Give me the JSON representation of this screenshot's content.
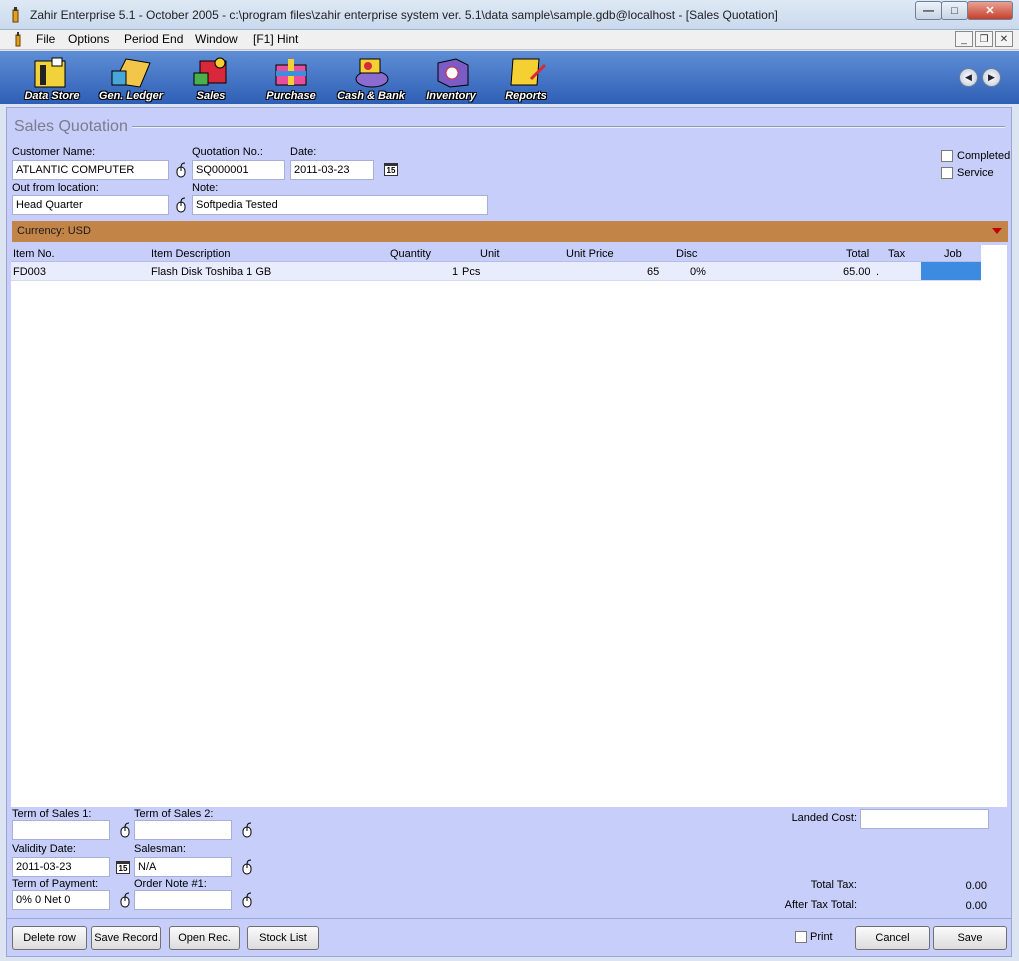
{
  "window": {
    "title": "Zahir Enterprise 5.1 - October 2005 - c:\\program files\\zahir enterprise system ver. 5.1\\data sample\\sample.gdb@localhost - [Sales Quotation]"
  },
  "menu": {
    "items": [
      "File",
      "Options",
      "Period End",
      "Window",
      "[F1] Hint"
    ]
  },
  "toolbar": {
    "buttons": [
      "Data Store",
      "Gen. Ledger",
      "Sales",
      "Purchase",
      "Cash & Bank",
      "Inventory",
      "Reports"
    ]
  },
  "form": {
    "title": "Sales Quotation",
    "customer_label": "Customer Name:",
    "customer_value": "ATLANTIC COMPUTER",
    "quotation_label": "Quotation No.:",
    "quotation_value": "SQ000001",
    "date_label": "Date:",
    "date_value": "2011-03-23",
    "location_label": "Out from location:",
    "location_value": "Head Quarter",
    "note_label": "Note:",
    "note_value": "Softpedia Tested",
    "completed_label": "Completed",
    "service_label": "Service",
    "currency_text": "Currency: USD"
  },
  "grid": {
    "columns": [
      "Item No.",
      "Item Description",
      "Quantity",
      "Unit",
      "Unit Price",
      "Disc",
      "Total",
      "Tax",
      "Job"
    ],
    "rows": [
      {
        "item_no": "FD003",
        "description": "Flash Disk Toshiba 1 GB",
        "quantity": "1",
        "unit": "Pcs",
        "unit_price": "65",
        "disc": "0%",
        "total": "65.00",
        "tax": ".",
        "job": ""
      }
    ]
  },
  "footer": {
    "term1_label": "Term of Sales 1:",
    "term1_value": "",
    "term2_label": "Term of Sales 2:",
    "term2_value": "",
    "validity_label": "Validity Date:",
    "validity_value": "2011-03-23",
    "salesman_label": "Salesman:",
    "salesman_value": "N/A",
    "payment_label": "Term of Payment:",
    "payment_value": "0% 0 Net 0",
    "order_note_label": "Order Note #1:",
    "order_note_value": "",
    "landed_cost_label": "Landed Cost:",
    "landed_cost_value": "",
    "total_tax_label": "Total Tax:",
    "total_tax_value": "0.00",
    "after_tax_label": "After Tax Total:",
    "after_tax_value": "0.00"
  },
  "buttons": {
    "delete_row": "Delete row",
    "save_record": "Save Record",
    "open_rec": "Open Rec.",
    "stock_list": "Stock List",
    "print_label": "Print",
    "cancel": "Cancel",
    "save": "Save"
  },
  "calendar_glyph": "15",
  "colors": {
    "toolbar": "#2f5fb5",
    "form_bg": "#c6cef9",
    "currency_bar": "#c38448",
    "selected_cell": "#3d8be0"
  }
}
